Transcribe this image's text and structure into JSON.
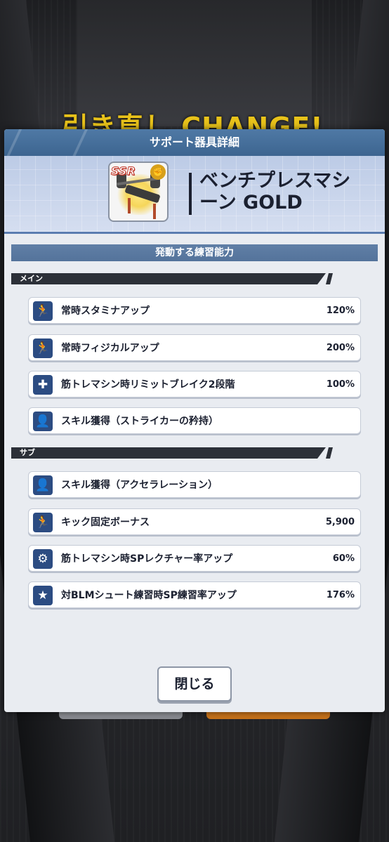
{
  "background": {
    "banner_text": "引き直し CHANGE!"
  },
  "modal": {
    "title": "サポート器具詳細",
    "item": {
      "rarity": "SSR",
      "type_icon": "fist-icon",
      "name": "ベンチプレスマシーン GOLD"
    },
    "section_title": "発動する練習能力",
    "main_label": "メイン",
    "sub_label": "サブ",
    "main_rows": [
      {
        "icon": "running-icon",
        "label": "常時スタミナアップ",
        "value": "120%"
      },
      {
        "icon": "running-icon",
        "label": "常時フィジカルアップ",
        "value": "200%"
      },
      {
        "icon": "puzzle-icon",
        "label": "筋トレマシン時リミットブレイク2段階",
        "value": "100%"
      },
      {
        "icon": "skill-person-icon",
        "label": "スキル獲得（ストライカーの矜持）",
        "value": ""
      }
    ],
    "sub_rows": [
      {
        "icon": "skill-person-icon",
        "label": "スキル獲得（アクセラレーション）",
        "value": ""
      },
      {
        "icon": "running-icon",
        "label": "キック固定ボーナス",
        "value": "5,900"
      },
      {
        "icon": "whistle-icon",
        "label": "筋トレマシン時SPレクチャー率アップ",
        "value": "60%"
      },
      {
        "icon": "star-icon",
        "label": "対BLMシュート練習時SP練習率アップ",
        "value": "176%"
      }
    ],
    "close_label": "閉じる"
  },
  "colors": {
    "title_bar": "#4a719c",
    "icon_bg": "#2c4c82",
    "banner_yellow": "#e8c21a"
  }
}
